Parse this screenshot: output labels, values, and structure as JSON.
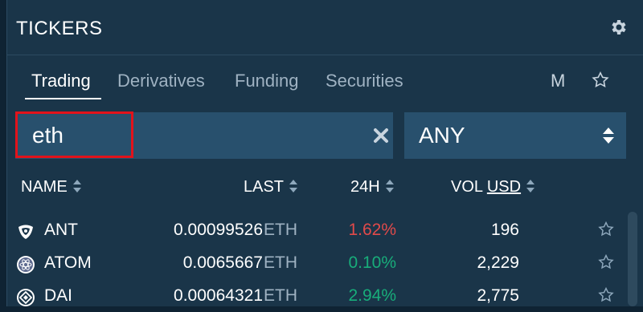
{
  "header": {
    "title": "TICKERS",
    "settings_icon": "gear-icon"
  },
  "tabs": {
    "items": [
      {
        "label": "Trading",
        "active": true
      },
      {
        "label": "Derivatives",
        "active": false
      },
      {
        "label": "Funding",
        "active": false
      },
      {
        "label": "Securities",
        "active": false
      }
    ],
    "m_label": "M",
    "favorites_icon": "star-outline-icon"
  },
  "search": {
    "value": "eth",
    "clear_icon": "close-x-icon"
  },
  "filter": {
    "selected": "ANY",
    "icon": "sort-arrows-icon"
  },
  "columns": {
    "name": "NAME",
    "last": "LAST",
    "change": "24H",
    "vol": "VOL",
    "vol_currency": "USD"
  },
  "rows": [
    {
      "icon": "ant-logo-icon",
      "name": "ANT",
      "last": "0.00099526",
      "unit": "ETH",
      "change": "1.62%",
      "direction": "down",
      "volume": "196"
    },
    {
      "icon": "atom-logo-icon",
      "name": "ATOM",
      "last": "0.0065667",
      "unit": "ETH",
      "change": "0.10%",
      "direction": "up",
      "volume": "2,229"
    },
    {
      "icon": "dai-logo-icon",
      "name": "DAI",
      "last": "0.00064321",
      "unit": "ETH",
      "change": "2.94%",
      "direction": "up",
      "volume": "2,775"
    }
  ],
  "colors": {
    "up": "#18ad7a",
    "down": "#e14a4a",
    "accent_border": "#e2131b",
    "panel": "#1a3549",
    "input": "#28506d"
  }
}
